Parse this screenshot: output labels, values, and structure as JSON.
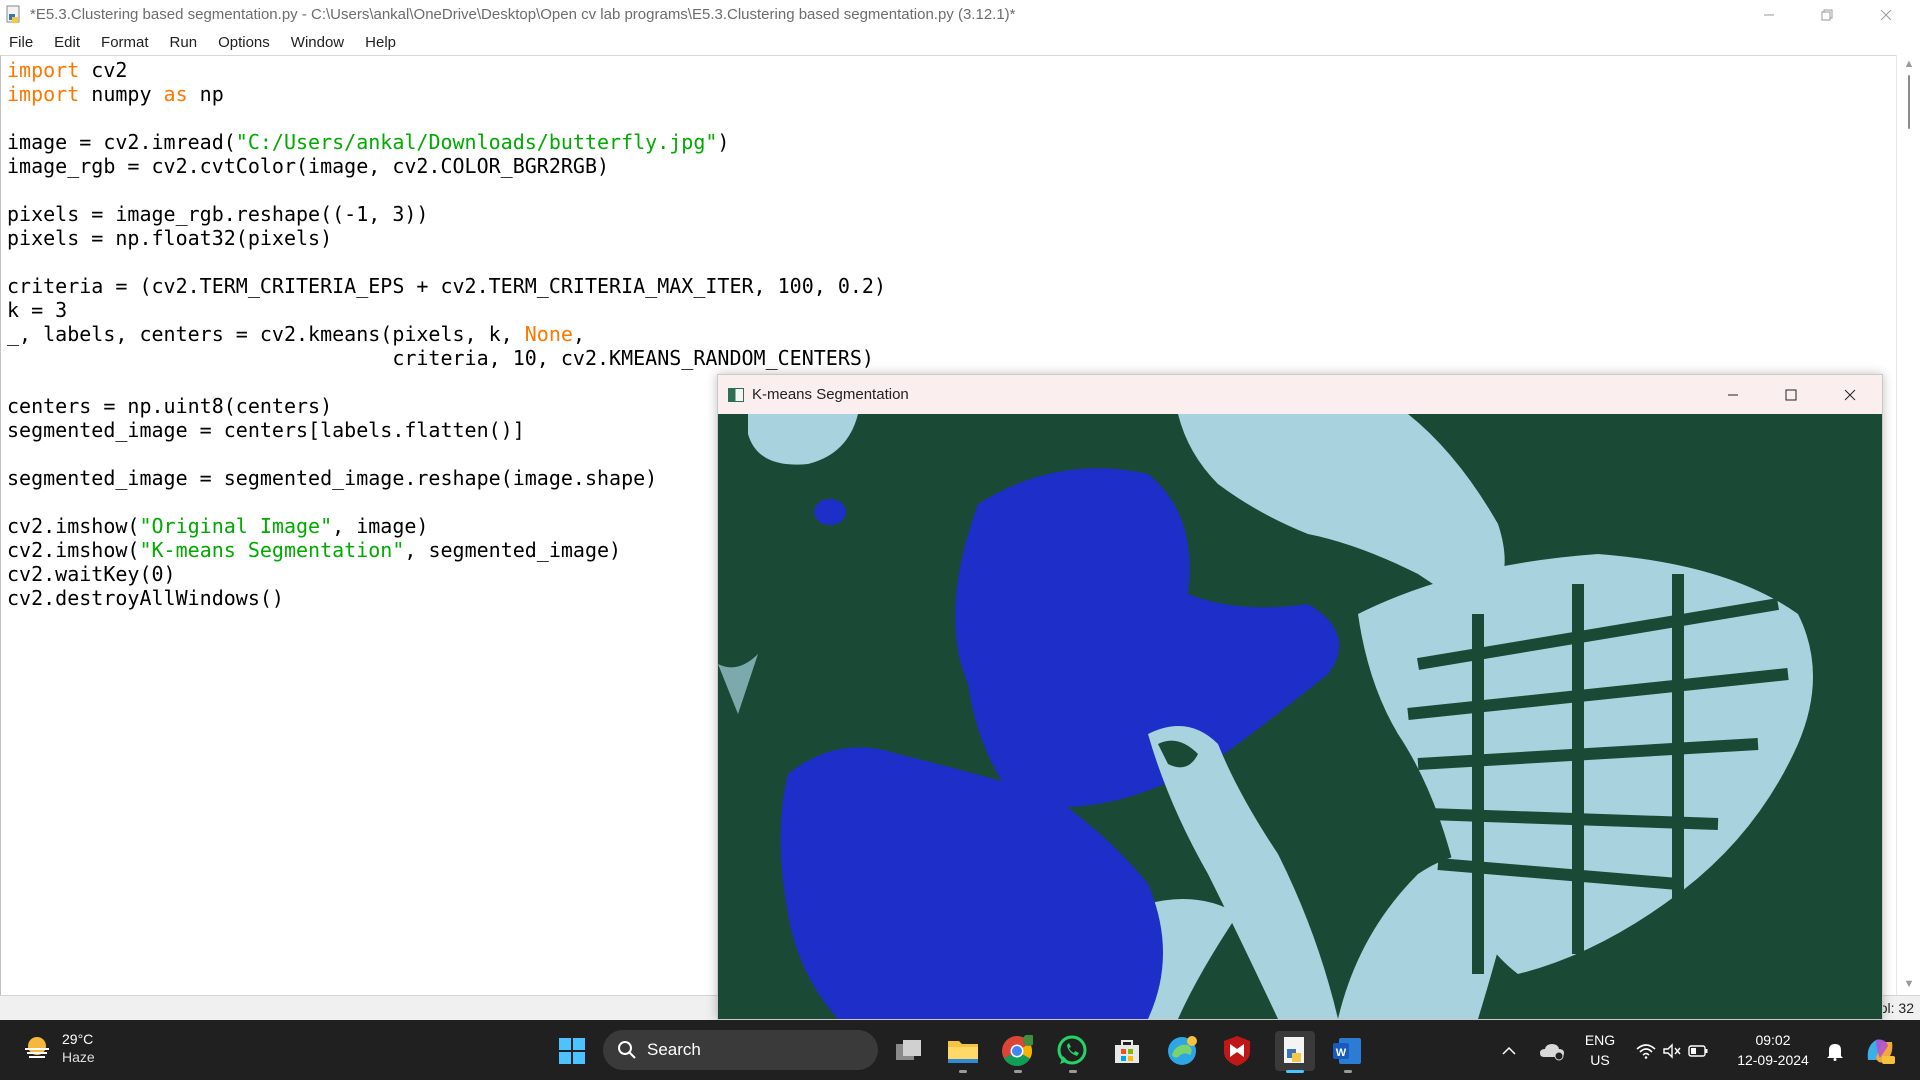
{
  "idle": {
    "title": "*E5.3.Clustering based segmentation.py - C:\\Users\\ankal\\OneDrive\\Desktop\\Open cv lab programs\\E5.3.Clustering based segmentation.py (3.12.1)*",
    "menu": [
      "File",
      "Edit",
      "Format",
      "Run",
      "Options",
      "Window",
      "Help"
    ],
    "status_col": "ol: 32",
    "code_lines": [
      [
        {
          "t": "import",
          "c": "kw"
        },
        {
          "t": " cv2"
        }
      ],
      [
        {
          "t": "import",
          "c": "kw"
        },
        {
          "t": " numpy "
        },
        {
          "t": "as",
          "c": "kw"
        },
        {
          "t": " np"
        }
      ],
      [],
      [
        {
          "t": "image = cv2.imread("
        },
        {
          "t": "\"C:/Users/ankal/Downloads/butterfly.jpg\"",
          "c": "str"
        },
        {
          "t": ")"
        }
      ],
      [
        {
          "t": "image_rgb = cv2.cvtColor(image, cv2.COLOR_BGR2RGB)"
        }
      ],
      [],
      [
        {
          "t": "pixels = image_rgb.reshape((-1, 3))"
        }
      ],
      [
        {
          "t": "pixels = np.float32(pixels)"
        }
      ],
      [],
      [
        {
          "t": "criteria = (cv2.TERM_CRITERIA_EPS + cv2.TERM_CRITERIA_MAX_ITER, 100, 0.2)"
        }
      ],
      [
        {
          "t": "k = 3"
        }
      ],
      [
        {
          "t": "_, labels, centers = cv2.kmeans(pixels, k, "
        },
        {
          "t": "None",
          "c": "kw"
        },
        {
          "t": ","
        }
      ],
      [
        {
          "t": "                                criteria, 10, cv2.KMEANS_RANDOM_CENTERS)"
        }
      ],
      [],
      [
        {
          "t": "centers = np.uint8(centers)"
        }
      ],
      [
        {
          "t": "segmented_image = centers[labels.flatten()]"
        }
      ],
      [],
      [
        {
          "t": "segmented_image = segmented_image.reshape(image.shape)"
        }
      ],
      [],
      [
        {
          "t": "cv2.imshow("
        },
        {
          "t": "\"Original Image\"",
          "c": "str"
        },
        {
          "t": ", image)"
        }
      ],
      [
        {
          "t": "cv2.imshow("
        },
        {
          "t": "\"K-means Segmentation\"",
          "c": "str"
        },
        {
          "t": ", segmented_image)"
        }
      ],
      [
        {
          "t": "cv2.waitKey(0)"
        }
      ],
      [
        {
          "t": "cv2.destroyAllWindows()"
        }
      ]
    ]
  },
  "cv_window": {
    "title": "K-means Segmentation",
    "cluster_colors": [
      "#1a4a35",
      "#a7d2de",
      "#1e2ec8"
    ]
  },
  "taskbar": {
    "weather_temp": "29°C",
    "weather_cond": "Haze",
    "search_label": "Search",
    "lang_top": "ENG",
    "lang_bottom": "US",
    "time": "09:02",
    "date": "12-09-2024",
    "icons": [
      "task-view-icon",
      "file-explorer-icon",
      "chrome-icon",
      "whatsapp-icon",
      "microsoft-store-icon",
      "edge-icon",
      "mcafee-icon",
      "idle-python-icon",
      "word-icon"
    ]
  }
}
